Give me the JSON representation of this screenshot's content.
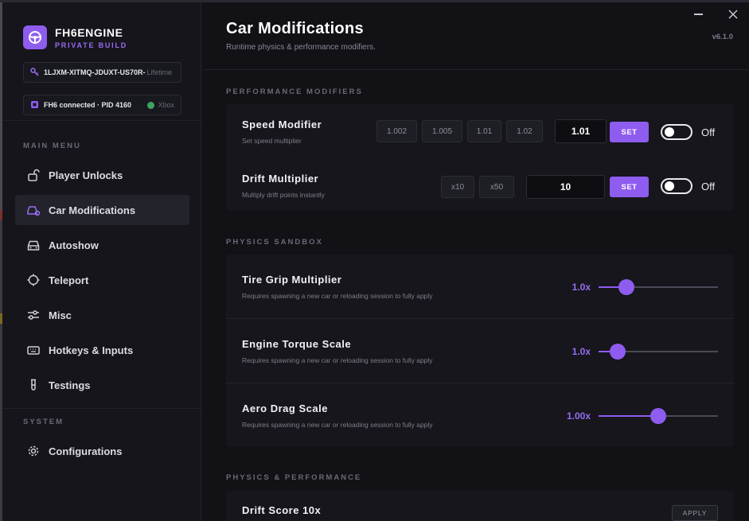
{
  "brand": {
    "name": "FH6ENGINE",
    "subtitle": "PRIVATE BUILD",
    "accent": "#8f5cf0"
  },
  "license": {
    "key": "1LJXM-XITMQ-JDUXT-US70R-",
    "tier": "Lifetime"
  },
  "connection": {
    "status": "FH6 connected · PID 4160",
    "platform": "Xbox"
  },
  "sidebar": {
    "main_label": "MAIN MENU",
    "items": [
      {
        "label": "Player Unlocks",
        "icon": "lock-open-icon"
      },
      {
        "label": "Car Modifications",
        "icon": "car-gear-icon",
        "active": true
      },
      {
        "label": "Autoshow",
        "icon": "car-icon"
      },
      {
        "label": "Teleport",
        "icon": "crosshair-icon"
      },
      {
        "label": "Misc",
        "icon": "sliders-icon"
      },
      {
        "label": "Hotkeys & Inputs",
        "icon": "keyboard-icon"
      },
      {
        "label": "Testings",
        "icon": "test-tube-icon"
      }
    ],
    "system_label": "SYSTEM",
    "system_items": [
      {
        "label": "Configurations",
        "icon": "gear-icon"
      }
    ]
  },
  "header": {
    "title": "Car Modifications",
    "subtitle": "Runtime physics & performance modifiers.",
    "version": "v6.1.0"
  },
  "performance": {
    "label": "PERFORMANCE MODIFIERS",
    "speed": {
      "title": "Speed Modifier",
      "desc": "Set speed multiplier",
      "presets": [
        "1.002",
        "1.005",
        "1.01",
        "1.02"
      ],
      "value": "1.01",
      "set_label": "SET",
      "toggle_label": "Off"
    },
    "drift": {
      "title": "Drift Multiplier",
      "desc": "Multiply drift points instantly",
      "presets": [
        "x10",
        "x50"
      ],
      "value": "10",
      "set_label": "SET",
      "toggle_label": "Off"
    }
  },
  "physics": {
    "label": "PHYSICS SANDBOX",
    "sliders": [
      {
        "title": "Tire Grip Multiplier",
        "desc": "Requires spawning a new car or reloading session to fully apply",
        "value": "1.0x",
        "fraction": 0.23
      },
      {
        "title": "Engine Torque Scale",
        "desc": "Requires spawning a new car or reloading session to fully apply",
        "value": "1.0x",
        "fraction": 0.16
      },
      {
        "title": "Aero Drag Scale",
        "desc": "Requires spawning a new car or reloading session to fully apply",
        "value": "1.00x",
        "fraction": 0.5
      }
    ]
  },
  "physics_perf": {
    "label": "PHYSICS & PERFORMANCE",
    "drift_score": {
      "title": "Drift Score 10x",
      "apply_label": "APPLY"
    }
  }
}
